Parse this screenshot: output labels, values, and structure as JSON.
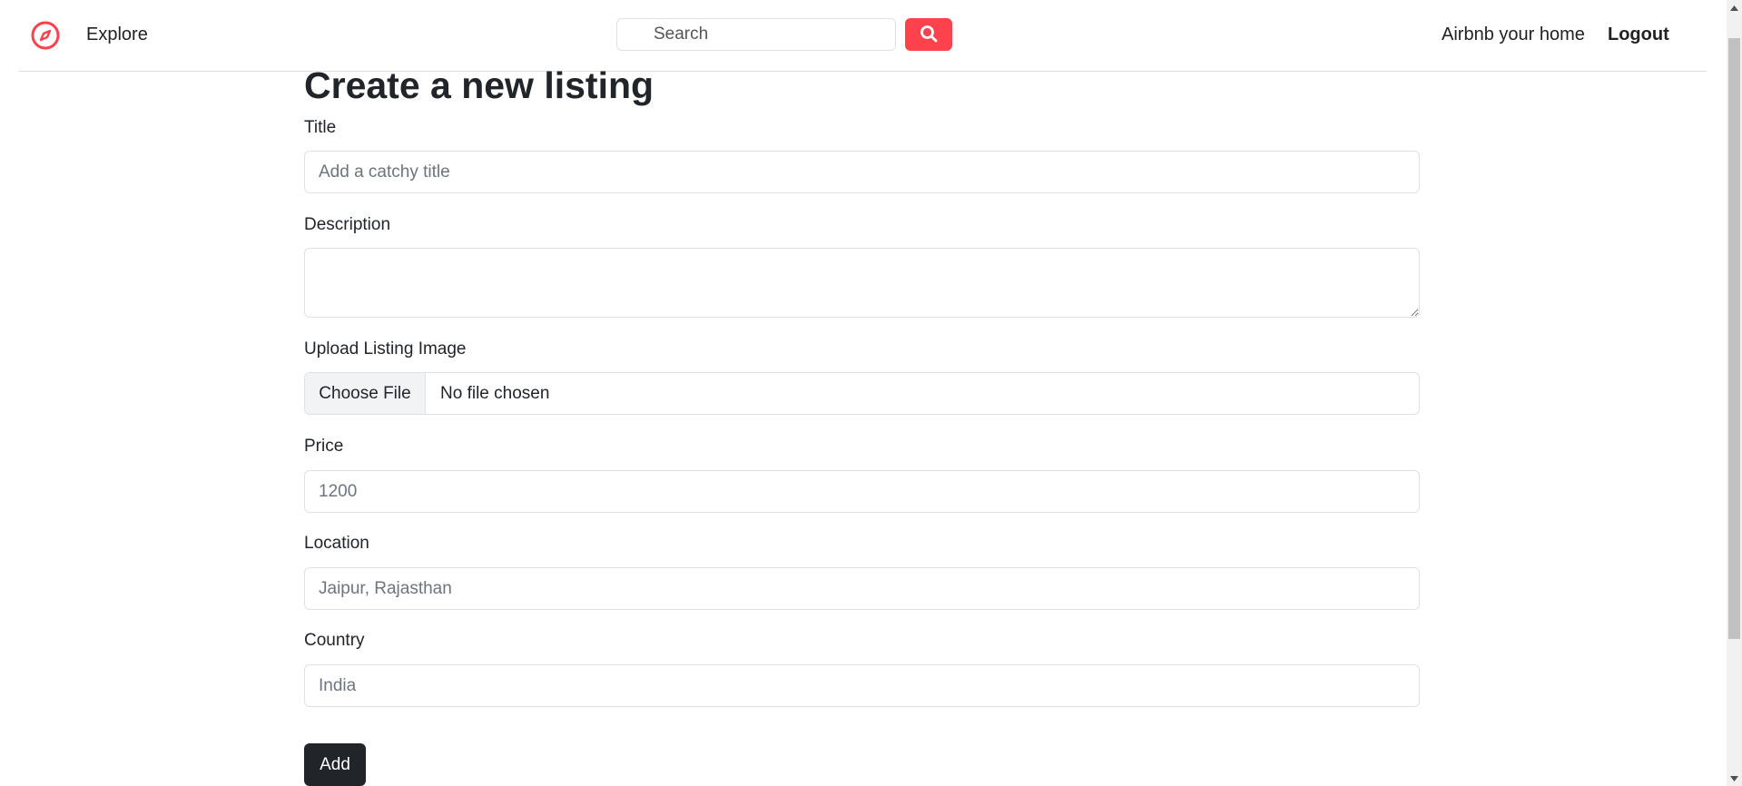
{
  "nav": {
    "logo_icon": "compass-icon",
    "explore_label": "Explore",
    "search_placeholder": "Search",
    "search_icon": "search-icon",
    "host_label": "Airbnb your home",
    "logout_label": "Logout",
    "brand_color": "#fe424d"
  },
  "page": {
    "title": "Create a new listing"
  },
  "form": {
    "title_label": "Title",
    "title_placeholder": "Add a catchy title",
    "description_label": "Description",
    "image_label": "Upload Listing Image",
    "choose_file_label": "Choose File",
    "file_status": "No file chosen",
    "price_label": "Price",
    "price_placeholder": "1200",
    "location_label": "Location",
    "location_placeholder": "Jaipur, Rajasthan",
    "country_label": "Country",
    "country_placeholder": "India",
    "submit_label": "Add"
  }
}
